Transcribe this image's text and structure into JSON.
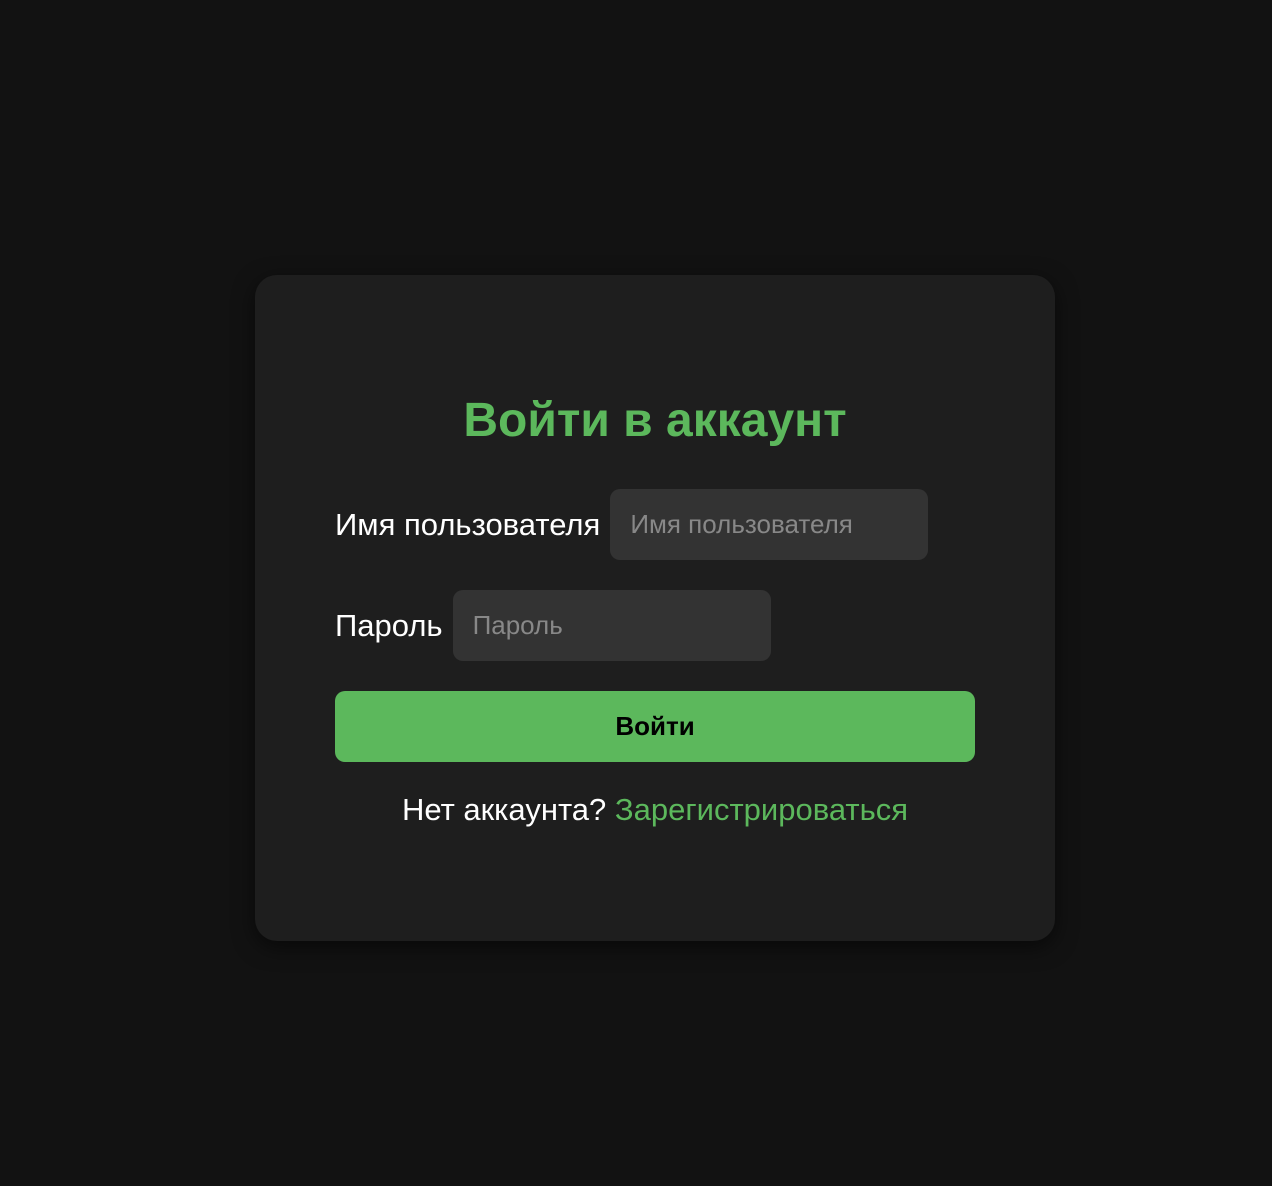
{
  "colors": {
    "page_background": "#121212",
    "card_background": "#1e1e1e",
    "accent": "#5cb85c",
    "input_background": "#333333",
    "text": "#ffffff",
    "placeholder": "#888888"
  },
  "login": {
    "title": "Войти в аккаунт",
    "username": {
      "label": "Имя пользователя",
      "placeholder": "Имя пользователя",
      "value": ""
    },
    "password": {
      "label": "Пароль",
      "placeholder": "Пароль",
      "value": ""
    },
    "submit_label": "Войти",
    "footer": {
      "prompt": "Нет аккаунта?",
      "register_link": "Зарегистрироваться"
    }
  }
}
